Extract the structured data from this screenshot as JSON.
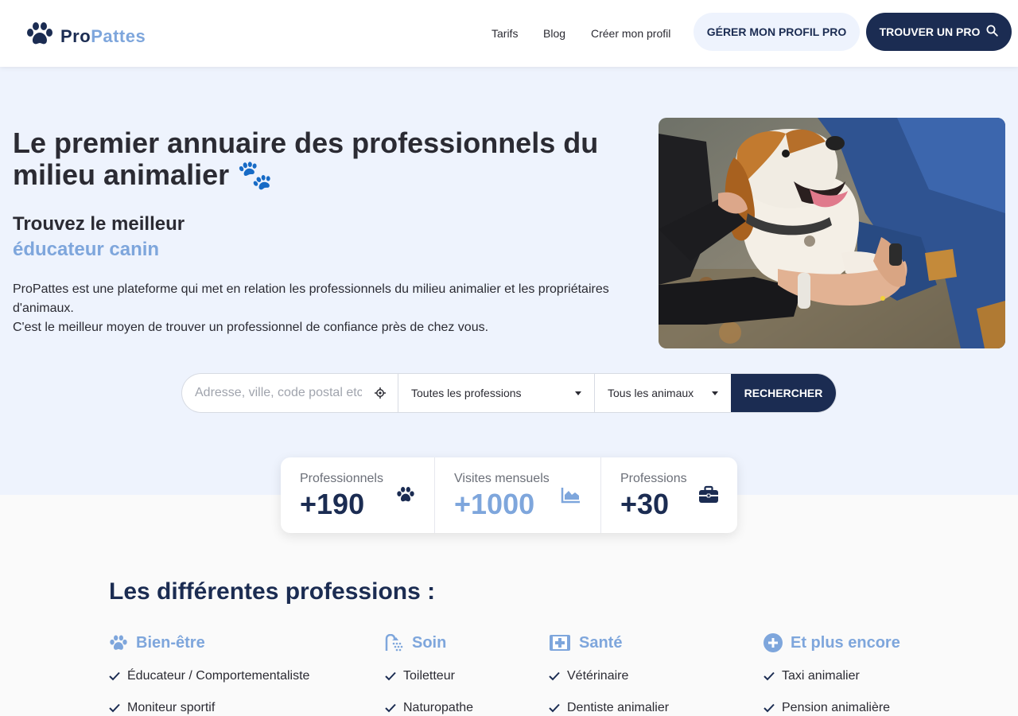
{
  "brand": {
    "name_part1": "Pro",
    "name_part2": "Pattes",
    "primary": "#1b2c52",
    "accent": "#7ea6dc",
    "hero_bg": "#eef3fd"
  },
  "nav": {
    "links": [
      "Tarifs",
      "Blog",
      "Créer mon profil"
    ],
    "manage_label": "GÉRER MON PROFIL PRO",
    "find_label": "TROUVER UN PRO"
  },
  "hero": {
    "title": "Le premier annuaire des professionnels du milieu animalier 🐾",
    "subtitle": "Trouvez le meilleur",
    "subtitle_highlight": "éducateur canin",
    "description_line1": "ProPattes est une plateforme qui met en relation les professionnels du milieu animalier et les propriétaires d'animaux.",
    "description_line2": "C'est le meilleur moyen de trouver un professionnel de confiance près de chez vous."
  },
  "search": {
    "placeholder": "Adresse, ville, code postal etc",
    "profession_selected": "Toutes les professions",
    "animal_selected": "Tous les animaux",
    "submit_label": "RECHERCHER"
  },
  "stats": [
    {
      "label": "Professionnels",
      "value": "+190",
      "icon": "paw-icon"
    },
    {
      "label": "Visites mensuels",
      "value": "+1000",
      "icon": "area-chart-icon"
    },
    {
      "label": "Professions",
      "value": "+30",
      "icon": "briefcase-icon"
    }
  ],
  "professions": {
    "title": "Les différentes professions :",
    "columns": [
      {
        "title": "Bien-être",
        "icon": "paw-icon",
        "items": [
          "Éducateur / Comportementaliste",
          "Moniteur sportif"
        ]
      },
      {
        "title": "Soin",
        "icon": "shower-icon",
        "items": [
          "Toiletteur",
          "Naturopathe"
        ]
      },
      {
        "title": "Santé",
        "icon": "medical-plus-icon",
        "items": [
          "Vétérinaire",
          "Dentiste animalier"
        ]
      },
      {
        "title": "Et plus encore",
        "icon": "plus-circle-icon",
        "items": [
          "Taxi animalier",
          "Pension animalière"
        ]
      }
    ]
  }
}
